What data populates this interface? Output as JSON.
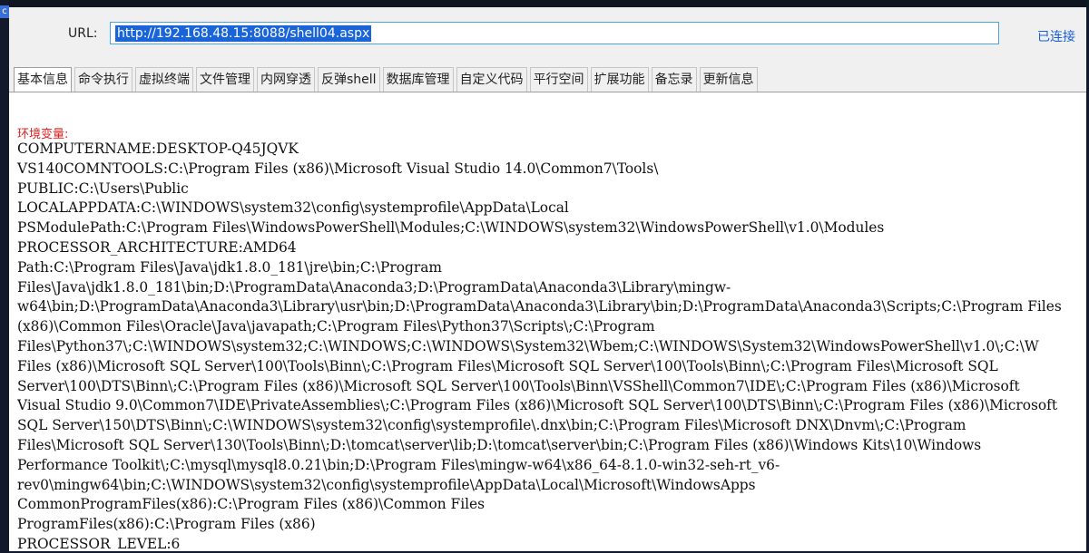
{
  "window": {
    "icon_glyph": "c"
  },
  "url_bar": {
    "label": "URL:",
    "value": "http://192.168.48.15:8088/shell04.aspx",
    "status": "已连接"
  },
  "tabs": [
    {
      "label": "基本信息",
      "active": true
    },
    {
      "label": "命令执行"
    },
    {
      "label": "虚拟终端"
    },
    {
      "label": "文件管理"
    },
    {
      "label": "内网穿透"
    },
    {
      "label": "反弹shell"
    },
    {
      "label": "数据库管理"
    },
    {
      "label": "自定义代码"
    },
    {
      "label": "平行空间"
    },
    {
      "label": "扩展功能"
    },
    {
      "label": "备忘录"
    },
    {
      "label": "更新信息"
    }
  ],
  "content": {
    "section_title": "环境变量:",
    "lines": [
      "COMPUTERNAME:DESKTOP-Q45JQVK",
      "VS140COMNTOOLS:C:\\Program Files (x86)\\Microsoft Visual Studio 14.0\\Common7\\Tools\\",
      "PUBLIC:C:\\Users\\Public",
      "LOCALAPPDATA:C:\\WINDOWS\\system32\\config\\systemprofile\\AppData\\Local",
      "PSModulePath:C:\\Program Files\\WindowsPowerShell\\Modules;C:\\WINDOWS\\system32\\WindowsPowerShell\\v1.0\\Modules",
      "PROCESSOR_ARCHITECTURE:AMD64",
      "Path:C:\\Program Files\\Java\\jdk1.8.0_181\\jre\\bin;C:\\Program",
      "Files\\Java\\jdk1.8.0_181\\bin;D:\\ProgramData\\Anaconda3;D:\\ProgramData\\Anaconda3\\Library\\mingw-",
      "w64\\bin;D:\\ProgramData\\Anaconda3\\Library\\usr\\bin;D:\\ProgramData\\Anaconda3\\Library\\bin;D:\\ProgramData\\Anaconda3\\Scripts;C:\\Program Files",
      "(x86)\\Common Files\\Oracle\\Java\\javapath;C:\\Program Files\\Python37\\Scripts\\;C:\\Program",
      "Files\\Python37\\;C:\\WINDOWS\\system32;C:\\WINDOWS;C:\\WINDOWS\\System32\\Wbem;C:\\WINDOWS\\System32\\WindowsPowerShell\\v1.0\\;C:\\W",
      "Files (x86)\\Microsoft SQL Server\\100\\Tools\\Binn\\;C:\\Program Files\\Microsoft SQL Server\\100\\Tools\\Binn\\;C:\\Program Files\\Microsoft SQL",
      "Server\\100\\DTS\\Binn\\;C:\\Program Files (x86)\\Microsoft SQL Server\\100\\Tools\\Binn\\VSShell\\Common7\\IDE\\;C:\\Program Files (x86)\\Microsoft",
      "Visual Studio 9.0\\Common7\\IDE\\PrivateAssemblies\\;C:\\Program Files (x86)\\Microsoft SQL Server\\100\\DTS\\Binn\\;C:\\Program Files (x86)\\Microsoft",
      "SQL Server\\150\\DTS\\Binn\\;C:\\WINDOWS\\system32\\config\\systemprofile\\.dnx\\bin;C:\\Program Files\\Microsoft DNX\\Dnvm\\;C:\\Program",
      "Files\\Microsoft SQL Server\\130\\Tools\\Binn\\;D:\\tomcat\\server\\lib;D:\\tomcat\\server\\bin;C:\\Program Files (x86)\\Windows Kits\\10\\Windows",
      "Performance Toolkit\\;C:\\mysql\\mysql8.0.21\\bin;D:\\Program Files\\mingw-w64\\x86_64-8.1.0-win32-seh-rt_v6-",
      "rev0\\mingw64\\bin;C:\\WINDOWS\\system32\\config\\systemprofile\\AppData\\Local\\Microsoft\\WindowsApps",
      "CommonProgramFiles(x86):C:\\Program Files (x86)\\Common Files",
      "ProgramFiles(x86):C:\\Program Files (x86)",
      "PROCESSOR_LEVEL:6"
    ]
  }
}
